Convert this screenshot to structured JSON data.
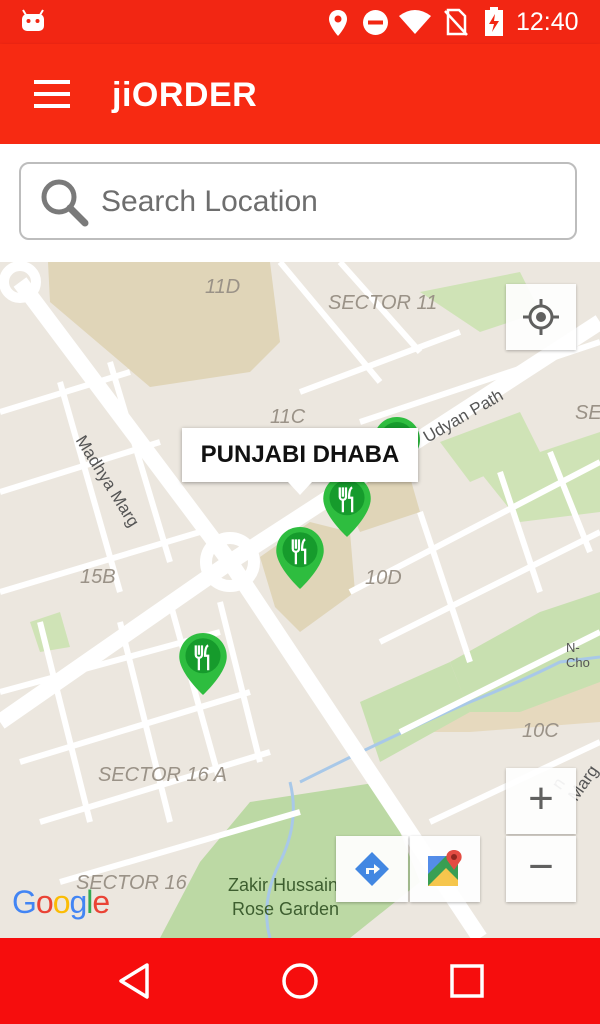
{
  "status_bar": {
    "time": "12:40",
    "icons": [
      "android-icon",
      "location-icon",
      "do-not-disturb-icon",
      "wifi-icon",
      "no-sim-icon",
      "battery-charging-icon"
    ]
  },
  "app_bar": {
    "title": "jiORDER",
    "menu_icon": "hamburger-menu-icon"
  },
  "search": {
    "placeholder": "Search Location",
    "icon": "search-icon"
  },
  "map": {
    "area_labels": [
      "11D",
      "SECTOR 11",
      "11C",
      "SE",
      "10D",
      "15B",
      "10C",
      "SECTOR 16 A",
      "SECTOR 16"
    ],
    "street_labels": [
      "Madhya Marg",
      "Udyan Path",
      "N-Cho",
      "n Marg"
    ],
    "park_label": "Zakir Hussain Rose Garden",
    "park_label_line1": "Zakir Hussain",
    "park_label_line2": "Rose Garden",
    "selected_place": "PUNJABI DHABA",
    "markers": [
      "restaurant-marker",
      "restaurant-marker",
      "restaurant-marker",
      "restaurant-marker"
    ],
    "attribution": "Google",
    "controls": {
      "my_location": "my-location-icon",
      "zoom_in": "+",
      "zoom_out": "−",
      "directions": "directions-icon",
      "open_maps": "google-maps-icon"
    }
  },
  "colors": {
    "app_red": "#f72a12",
    "nav_red": "#f60d0d",
    "marker_green": "#2ebd3f",
    "map_bg": "#ece7df"
  },
  "nav_bar": [
    "back-icon",
    "home-icon",
    "recents-icon"
  ]
}
